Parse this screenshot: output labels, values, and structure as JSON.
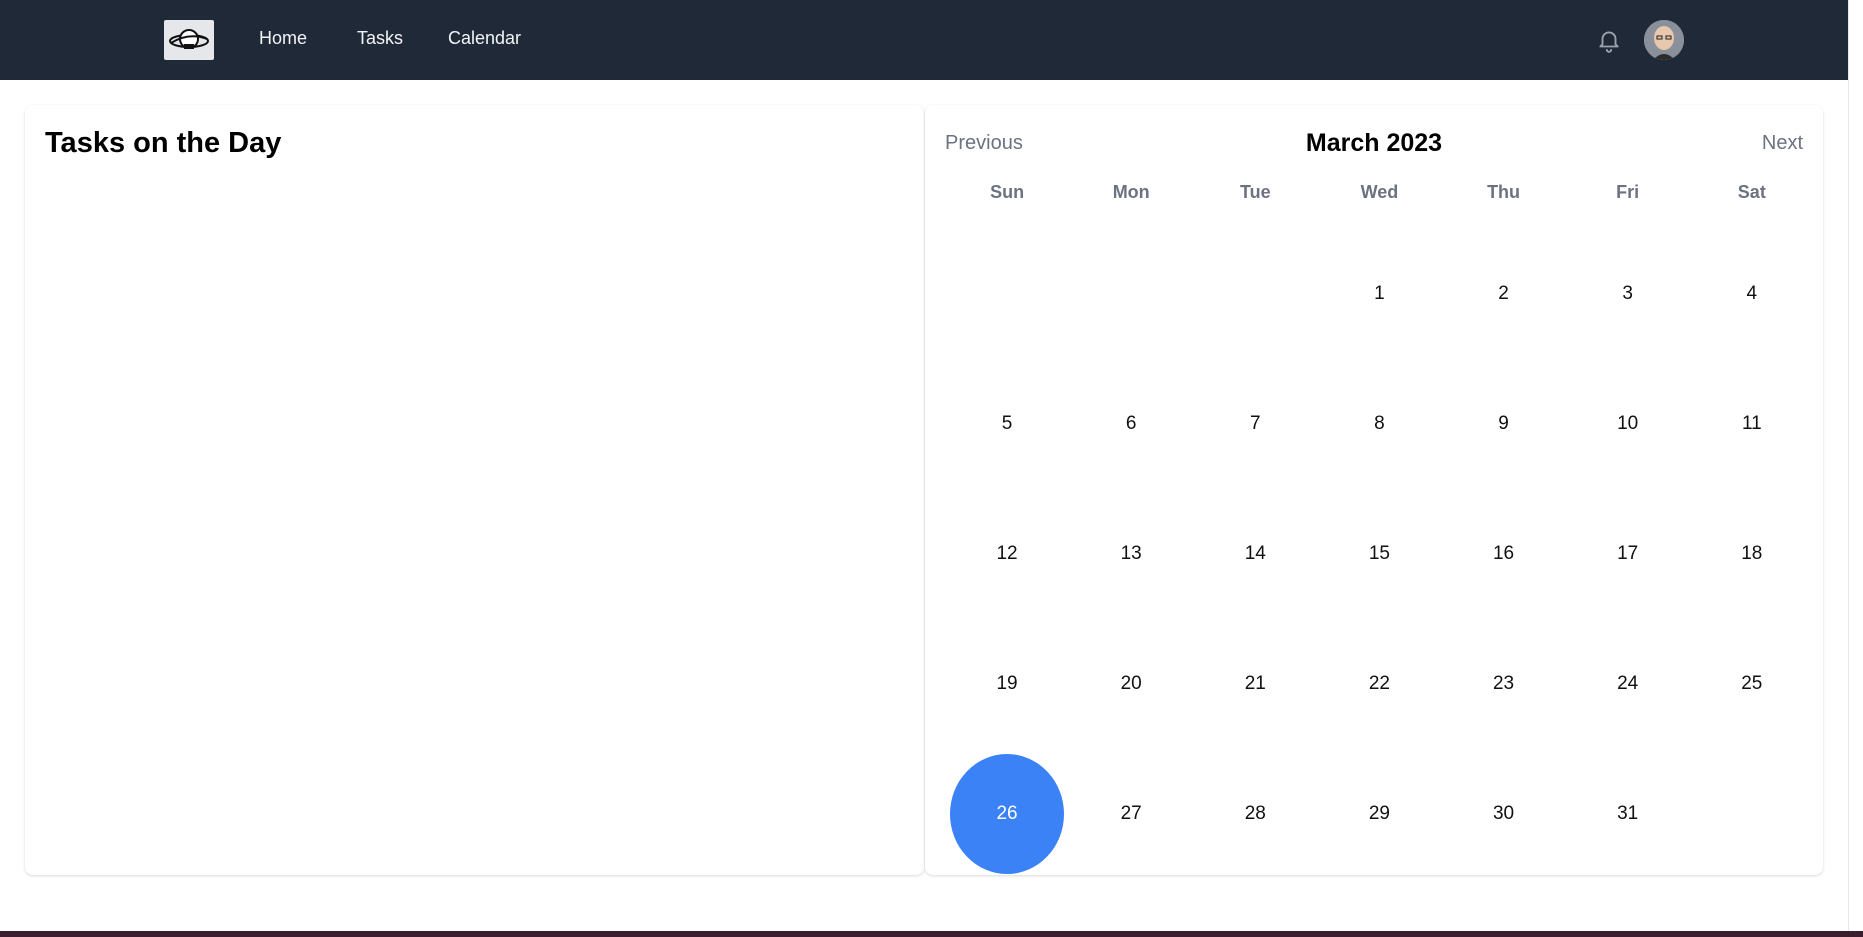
{
  "nav": {
    "logo_alt": "Planet logo",
    "links": [
      "Home",
      "Tasks",
      "Calendar"
    ]
  },
  "tasks_panel": {
    "title": "Tasks on the Day"
  },
  "calendar": {
    "previous_label": "Previous",
    "next_label": "Next",
    "month_label": "March 2023",
    "weekdays": [
      "Sun",
      "Mon",
      "Tue",
      "Wed",
      "Thu",
      "Fri",
      "Sat"
    ],
    "leading_blank_days": 3,
    "days": [
      "1",
      "2",
      "3",
      "4",
      "5",
      "6",
      "7",
      "8",
      "9",
      "10",
      "11",
      "12",
      "13",
      "14",
      "15",
      "16",
      "17",
      "18",
      "19",
      "20",
      "21",
      "22",
      "23",
      "24",
      "25",
      "26",
      "27",
      "28",
      "29",
      "30",
      "31"
    ],
    "selected_day": "26",
    "selected_color": "#3b82f6"
  },
  "colors": {
    "navbar": "#1f2937",
    "muted_text": "#6b7280"
  }
}
